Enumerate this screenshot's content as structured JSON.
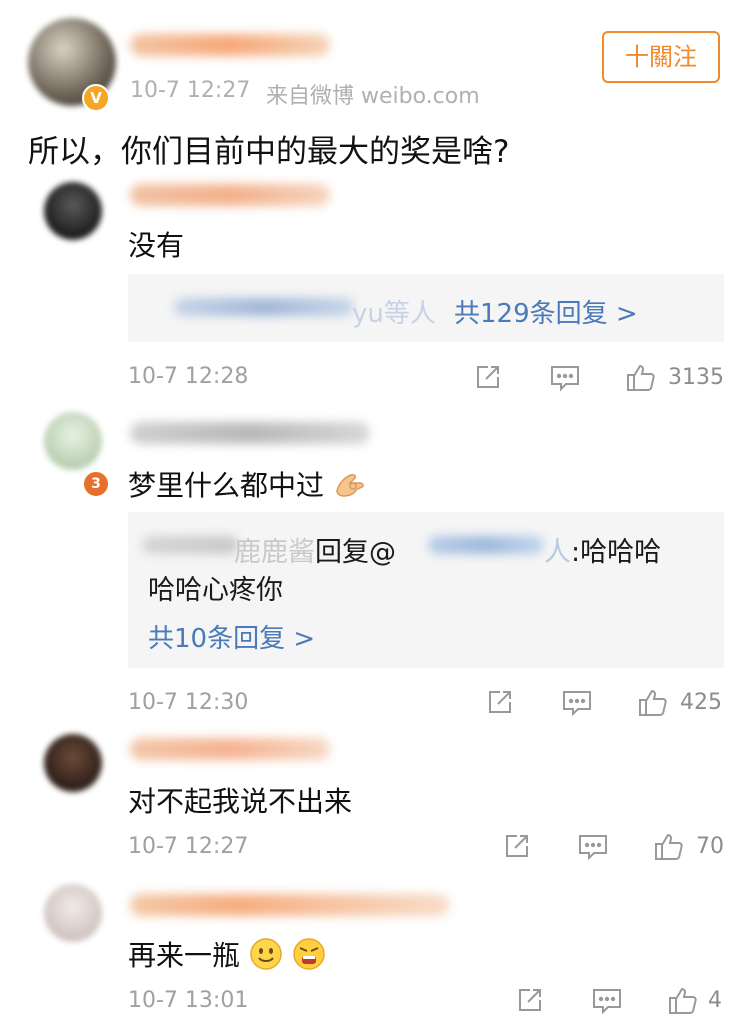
{
  "post": {
    "follow_label": "十關注",
    "timestamp": "10-7 12:27",
    "source": "来自微博 weibo.com",
    "text": "所以，你们目前中的最大的奖是啥?"
  },
  "comments": [
    {
      "text": "没有",
      "reply_summary_suffix": "yu等人",
      "reply_total": "共129条回复 >",
      "time": "10-7 12:28",
      "likes": "3135"
    },
    {
      "text": "梦里什么都中过",
      "reply_author_fragment": "鹿鹿酱",
      "reply_verb": "回复@",
      "reply_target_fragment": "人",
      "reply_content_1": ":哈哈哈",
      "reply_content_2": "哈哈心疼你",
      "reply_total": "共10条回复 >",
      "time": "10-7 12:30",
      "likes": "425"
    },
    {
      "text": "对不起我说不出来",
      "time": "10-7 12:27",
      "likes": "70"
    },
    {
      "text": "再来一瓶",
      "time": "10-7 13:01",
      "likes": "4"
    }
  ],
  "icons": {
    "share": "share-icon",
    "comment": "comment-icon",
    "like": "thumbs-up-icon",
    "ok_hand": "ok-hand-emoji",
    "smile": "smile-emoji",
    "angry": "angry-emoji"
  },
  "colors": {
    "accent_orange": "#f08a2a",
    "link_blue": "#4a7ab8",
    "meta_gray": "#999999",
    "reply_bg": "#f5f5f5"
  }
}
